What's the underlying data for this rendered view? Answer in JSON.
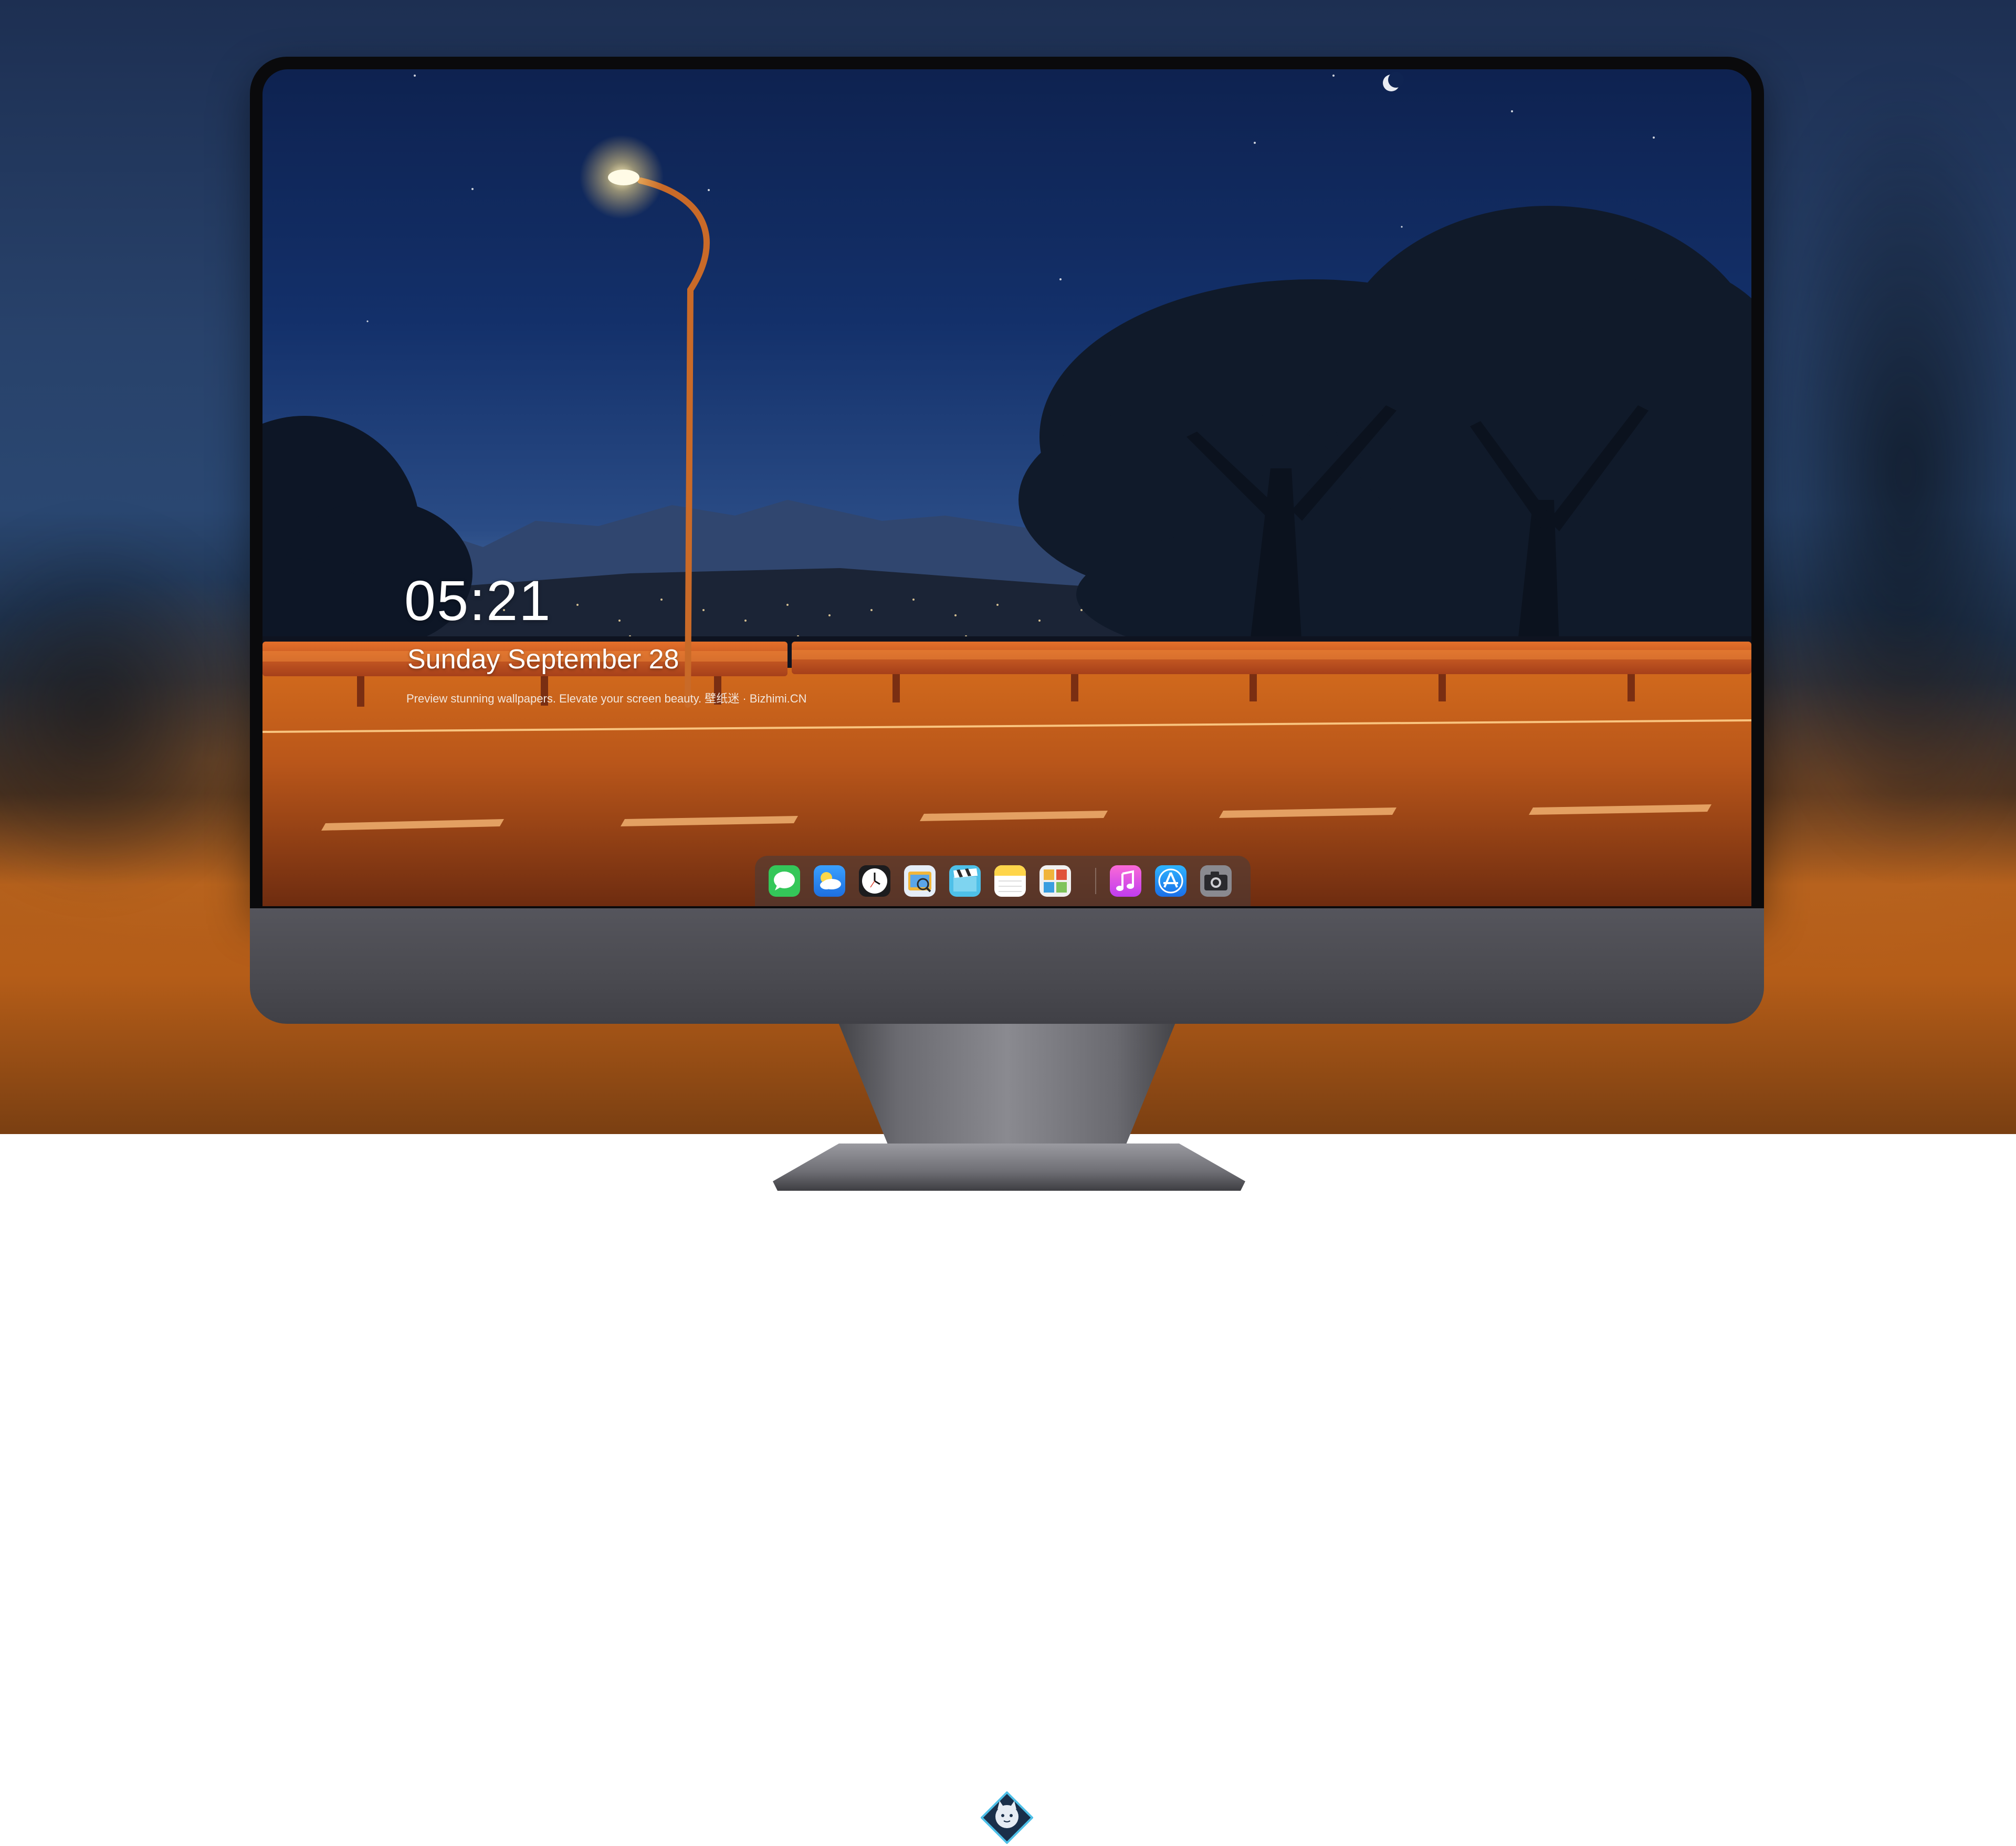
{
  "lockscreen": {
    "time": "05:21",
    "date": "Sunday September  28",
    "caption": "Preview stunning wallpapers. Elevate your screen beauty. 壁纸迷 · Bizhimi.CN"
  },
  "dock": {
    "apps": [
      {
        "icon": "messages-icon",
        "color": "#34c759"
      },
      {
        "icon": "weather-icon",
        "color": "#2f8cf5"
      },
      {
        "icon": "clock-icon",
        "color": "#1c1c1e"
      },
      {
        "icon": "preview-icon",
        "color": "#f1b63a"
      },
      {
        "icon": "clips-icon",
        "color": "#4ec0e8"
      },
      {
        "icon": "notes-icon",
        "color": "#ffd54a"
      },
      {
        "icon": "photos-icon",
        "color": "#7fc35a"
      },
      {
        "icon": "music-icon",
        "color": "#f25ac8"
      },
      {
        "icon": "app-store-icon",
        "color": "#1e8cf0"
      },
      {
        "icon": "camera-icon",
        "color": "#7a7a80"
      }
    ]
  },
  "colors": {
    "sky": "#13306a",
    "road": "#b05516",
    "railing": "#d25a1c",
    "lamp_glow": "#fff6c8"
  }
}
